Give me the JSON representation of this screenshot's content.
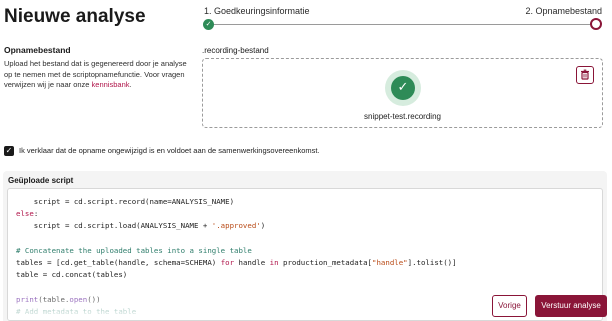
{
  "header": {
    "title": "Nieuwe analyse"
  },
  "stepper": {
    "steps": [
      {
        "label": "1. Goedkeuringsinformatie",
        "status": "completed"
      },
      {
        "label": "2. Opnamebestand",
        "status": "current"
      }
    ],
    "check_glyph": "✓",
    "colors": {
      "completed": "#2e8b57",
      "current": "#8a1538"
    }
  },
  "opname": {
    "heading": "Opnamebestand",
    "description": "Upload het bestand dat is gegenereerd door je analyse op te nemen met de scriptopnamefunctie. Voor vragen verwijzen wij je naar onze ",
    "link": "kennisbank",
    "after_link": "."
  },
  "upload": {
    "label": ".recording-bestand",
    "file_name": "snippet-test.recording",
    "check_glyph": "✓",
    "trash_icon": "trash-icon"
  },
  "consent": {
    "checked": true,
    "check_glyph": "✓",
    "text": "Ik verklaar dat de opname ongewijzigd is en voldoet aan de samenwerkingsovereenkomst."
  },
  "script": {
    "heading": "Geüploade script",
    "lines": [
      [
        {
          "t": "    script = cd.script.record(name=ANALYSIS_NAME)",
          "c": ""
        }
      ],
      [
        {
          "t": "else",
          "c": "kw"
        },
        {
          "t": ":",
          "c": ""
        }
      ],
      [
        {
          "t": "    script = cd.script.load(ANALYSIS_NAME + ",
          "c": ""
        },
        {
          "t": "'.approved'",
          "c": "str"
        },
        {
          "t": ")",
          "c": ""
        }
      ],
      [
        {
          "t": "",
          "c": ""
        }
      ],
      [
        {
          "t": "# Concatenate the uploaded tables into a single table",
          "c": "cmt"
        }
      ],
      [
        {
          "t": "tables = [cd.get_table(handle, schema=SCHEMA) ",
          "c": ""
        },
        {
          "t": "for",
          "c": "kw"
        },
        {
          "t": " handle ",
          "c": ""
        },
        {
          "t": "in",
          "c": "kw"
        },
        {
          "t": " production_metadata[",
          "c": ""
        },
        {
          "t": "\"handle\"",
          "c": "str"
        },
        {
          "t": "].tolist()]",
          "c": ""
        }
      ],
      [
        {
          "t": "table = cd.concat(tables)",
          "c": ""
        }
      ],
      [
        {
          "t": "",
          "c": ""
        }
      ],
      [
        {
          "t": "print",
          "c": "fn"
        },
        {
          "t": "(table.",
          "c": ""
        },
        {
          "t": "open",
          "c": "fn"
        },
        {
          "t": "())",
          "c": ""
        }
      ],
      [
        {
          "t": "# Add metadata to the table",
          "c": "cmt"
        }
      ]
    ]
  },
  "footer": {
    "prev_label": "Vorige",
    "submit_label": "Verstuur analyse"
  }
}
